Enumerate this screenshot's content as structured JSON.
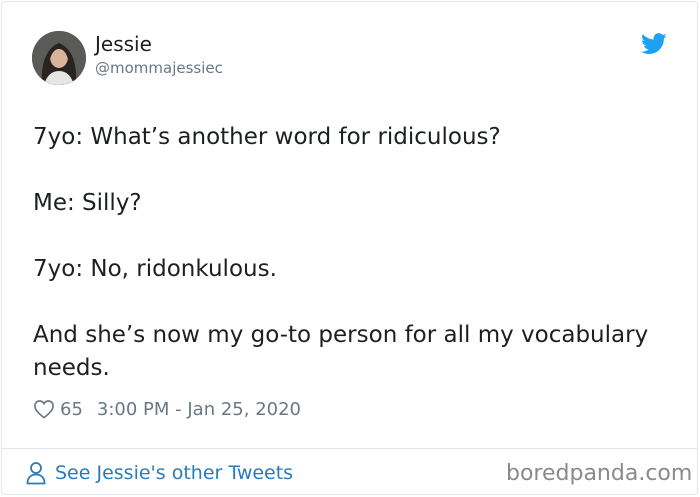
{
  "tweet": {
    "author": {
      "display_name": "Jessie",
      "handle": "@mommajessiec"
    },
    "lines": [
      "7yo: What’s another word for ridiculous?",
      "Me: Silly?",
      "7yo: No, ridonkulous.",
      "And she’s now my go-to person for all my vocabulary needs."
    ],
    "likes": "65",
    "timestamp": "3:00 PM - Jan 25, 2020"
  },
  "footer": {
    "see_more_label": "See Jessie's other Tweets"
  },
  "watermark": "boredpanda.com",
  "colors": {
    "twitter_blue": "#1da1f2",
    "link_blue": "#2b7bb9",
    "muted_gray": "#697882",
    "border": "#e1e8ed"
  },
  "icons": [
    "twitter-bird-icon",
    "heart-icon",
    "user-icon"
  ]
}
